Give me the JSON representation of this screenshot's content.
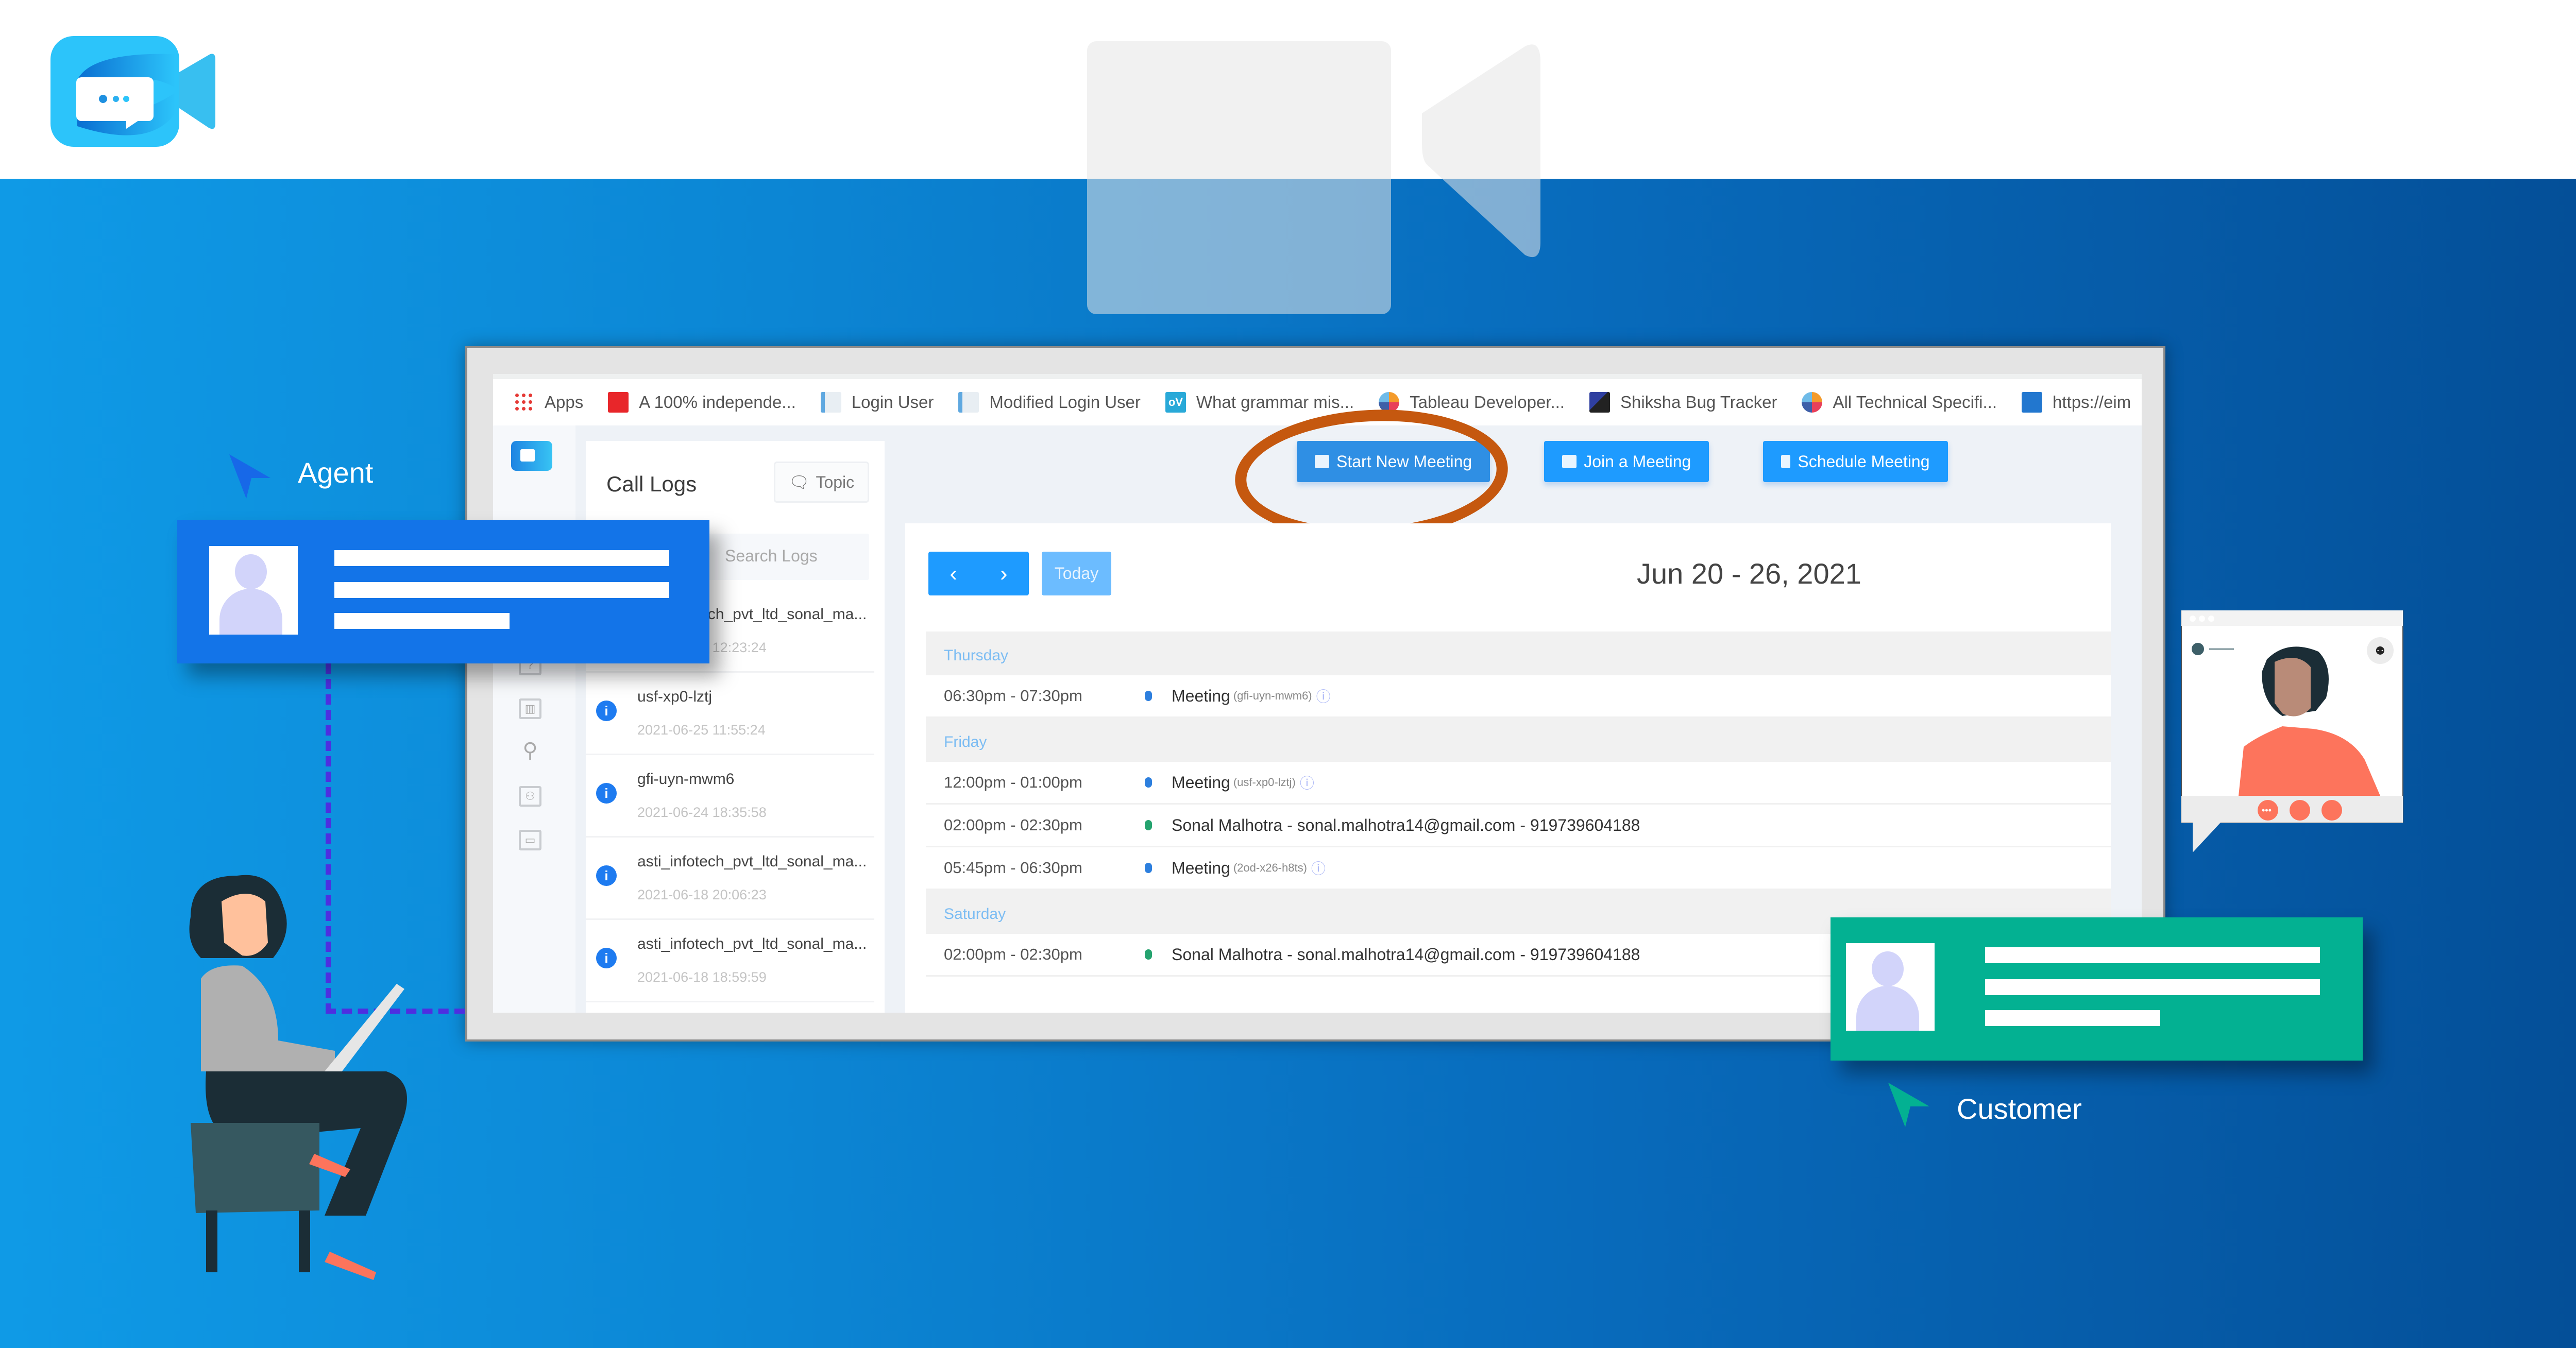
{
  "brand": {
    "logo_icon": "video-chat-logo-icon",
    "watermark_icon": "video-camera-icon"
  },
  "browser": {
    "bookmarks": [
      {
        "label": "Apps",
        "icon": "apps-grid-icon"
      },
      {
        "label": "A 100% independe...",
        "icon": "red-pin-icon"
      },
      {
        "label": "Login User",
        "icon": "document-icon"
      },
      {
        "label": "Modified Login User",
        "icon": "document-icon"
      },
      {
        "label": "What grammar mis...",
        "icon": "ov-icon"
      },
      {
        "label": "Tableau Developer...",
        "icon": "tableau-icon"
      },
      {
        "label": "Shiksha Bug Tracker",
        "icon": "shiksha-icon"
      },
      {
        "label": "All Technical Specifi...",
        "icon": "tableau-icon"
      },
      {
        "label": "https://eim",
        "icon": "link-icon"
      }
    ]
  },
  "app": {
    "rail_icons": [
      "history-icon",
      "list-icon",
      "help-icon",
      "chart-icon",
      "user-icon",
      "team-icon",
      "monitor-icon"
    ],
    "call_logs": {
      "title": "Call Logs",
      "topic_button": "Topic",
      "search_placeholder": "Search Logs",
      "items": [
        {
          "name": "asti_infotech_pvt_ltd_sonal_ma...",
          "time": "2021-06-25 12:23:24"
        },
        {
          "name": "usf-xp0-lztj",
          "time": "2021-06-25 11:55:24"
        },
        {
          "name": "gfi-uyn-mwm6",
          "time": "2021-06-24 18:35:58"
        },
        {
          "name": "asti_infotech_pvt_ltd_sonal_ma...",
          "time": "2021-06-18 20:06:23"
        },
        {
          "name": "asti_infotech_pvt_ltd_sonal_ma...",
          "time": "2021-06-18 18:59:59"
        }
      ]
    },
    "actions": {
      "start": "Start New Meeting",
      "join": "Join a Meeting",
      "schedule": "Schedule Meeting"
    },
    "calendar": {
      "today_label": "Today",
      "range": "Jun 20 - 26, 2021",
      "days": [
        {
          "day": "Thursday",
          "events": [
            {
              "time": "06:30pm - 07:30pm",
              "title": "Meeting",
              "code": "(gfi-uyn-mwm6)",
              "color": "#2d7fde",
              "info": true
            }
          ]
        },
        {
          "day": "Friday",
          "events": [
            {
              "time": "12:00pm - 01:00pm",
              "title": "Meeting",
              "code": "(usf-xp0-lztj)",
              "color": "#2d7fde",
              "info": true
            },
            {
              "time": "02:00pm - 02:30pm",
              "title": "Sonal Malhotra - sonal.malhotra14@gmail.com - 919739604188",
              "code": "",
              "color": "#25a36f",
              "info": false
            },
            {
              "time": "05:45pm - 06:30pm",
              "title": "Meeting",
              "code": "(2od-x26-h8ts)",
              "color": "#2d7fde",
              "info": true
            }
          ]
        },
        {
          "day": "Saturday",
          "events": [
            {
              "time": "02:00pm - 02:30pm",
              "title": "Sonal Malhotra - sonal.malhotra14@gmail.com - 919739604188",
              "code": "",
              "color": "#25a36f",
              "info": false
            }
          ]
        }
      ]
    }
  },
  "overlay": {
    "agent_label": "Agent",
    "customer_label": "Customer",
    "colors": {
      "agent": "#1374e8",
      "customer": "#03b192",
      "highlight": "#c5580f"
    }
  }
}
